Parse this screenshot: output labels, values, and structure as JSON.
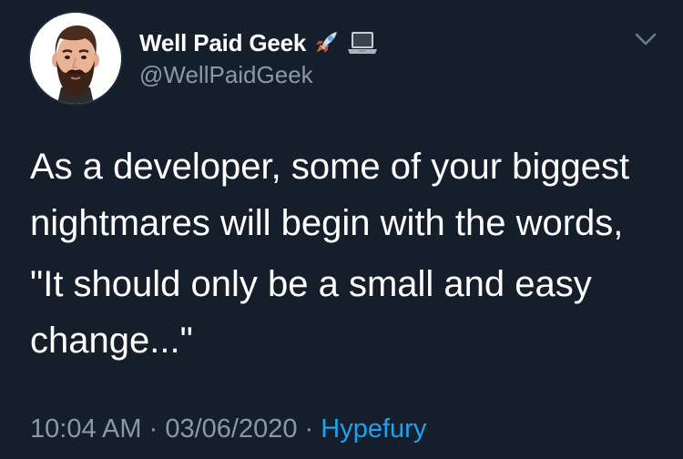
{
  "author": {
    "display_name": "Well Paid Geek",
    "handle": "@WellPaidGeek",
    "name_emojis": [
      "rocket-icon",
      "laptop-icon"
    ]
  },
  "tweet": {
    "paragraphs": [
      "As a developer, some of your biggest nightmares will begin with the words,",
      "\"It should only be a small and easy change...\""
    ],
    "time": "10:04 AM",
    "date": "03/06/2020",
    "separator": "·",
    "source": "Hypefury"
  },
  "colors": {
    "background": "#151f2c",
    "text": "#ffffff",
    "muted": "#8b99a7",
    "link": "#1da1f2"
  }
}
